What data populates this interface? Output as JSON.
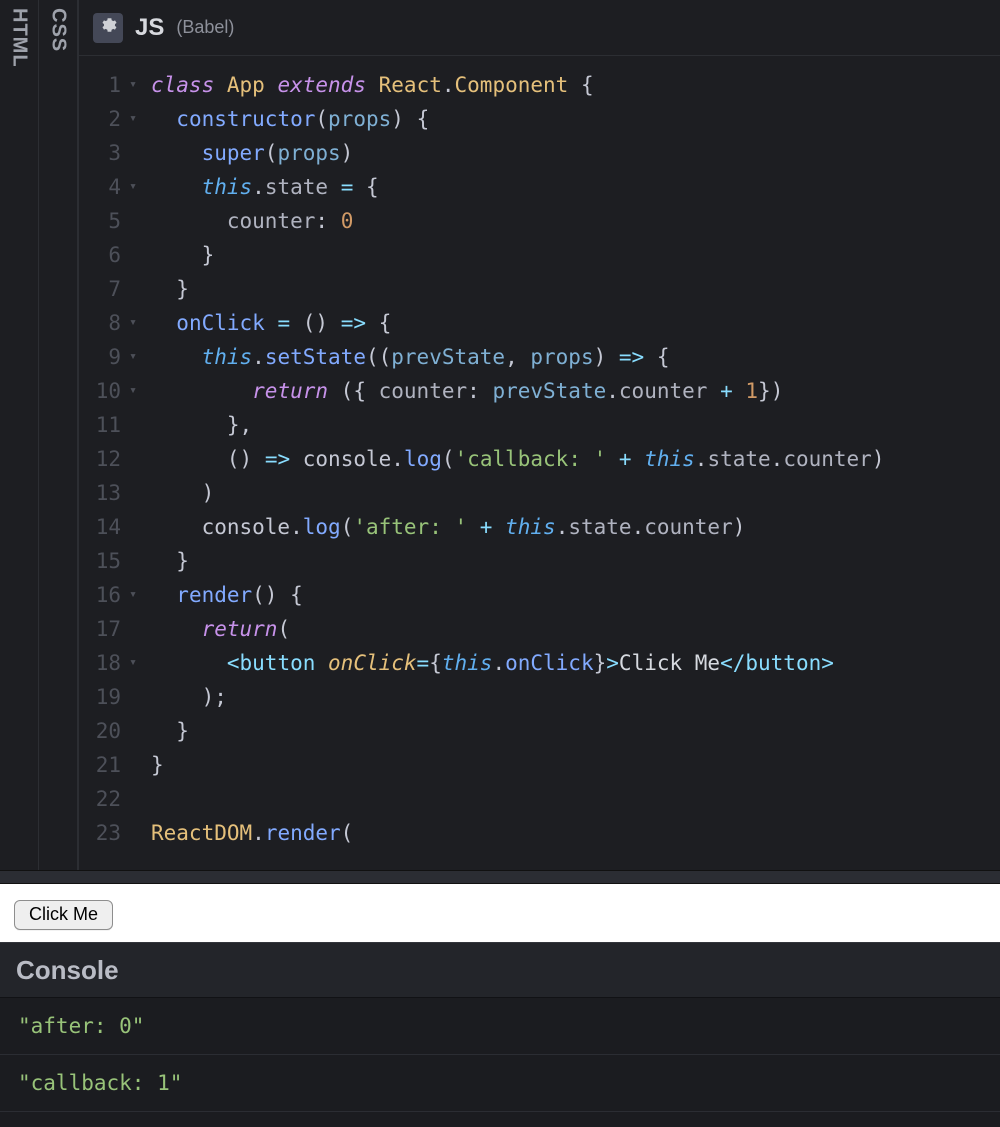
{
  "sideTabs": {
    "css": "CSS",
    "html": "HTML"
  },
  "editor": {
    "title": "JS",
    "subtitle": "(Babel)",
    "lines": [
      {
        "n": 1,
        "fold": true
      },
      {
        "n": 2,
        "fold": true
      },
      {
        "n": 3,
        "fold": false
      },
      {
        "n": 4,
        "fold": true
      },
      {
        "n": 5,
        "fold": false
      },
      {
        "n": 6,
        "fold": false
      },
      {
        "n": 7,
        "fold": false
      },
      {
        "n": 8,
        "fold": true
      },
      {
        "n": 9,
        "fold": true
      },
      {
        "n": 10,
        "fold": true
      },
      {
        "n": 11,
        "fold": false
      },
      {
        "n": 12,
        "fold": false
      },
      {
        "n": 13,
        "fold": false
      },
      {
        "n": 14,
        "fold": false
      },
      {
        "n": 15,
        "fold": false
      },
      {
        "n": 16,
        "fold": true
      },
      {
        "n": 17,
        "fold": false
      },
      {
        "n": 18,
        "fold": true
      },
      {
        "n": 19,
        "fold": false
      },
      {
        "n": 20,
        "fold": false
      },
      {
        "n": 21,
        "fold": false
      },
      {
        "n": 22,
        "fold": false
      },
      {
        "n": 23,
        "fold": false
      }
    ],
    "codeRows": [
      [
        [
          "kw",
          "class"
        ],
        [
          "",
          ""
        ],
        [
          "cls",
          "App"
        ],
        [
          "",
          ""
        ],
        [
          "kw",
          "extends"
        ],
        [
          "",
          ""
        ],
        [
          "cls",
          "React"
        ],
        [
          "punc",
          "."
        ],
        [
          "cls",
          "Component"
        ],
        [
          "",
          ""
        ],
        [
          "punc",
          "{"
        ]
      ],
      [
        [
          "",
          "  "
        ],
        [
          "fn",
          "constructor"
        ],
        [
          "punc",
          "("
        ],
        [
          "prop",
          "props"
        ],
        [
          "punc",
          ")"
        ],
        [
          "",
          ""
        ],
        [
          "punc",
          "{"
        ]
      ],
      [
        [
          "",
          "    "
        ],
        [
          "fn",
          "super"
        ],
        [
          "punc",
          "("
        ],
        [
          "prop",
          "props"
        ],
        [
          "punc",
          ")"
        ]
      ],
      [
        [
          "",
          "    "
        ],
        [
          "this",
          "this"
        ],
        [
          "punc",
          "."
        ],
        [
          "mem",
          "state"
        ],
        [
          "",
          ""
        ],
        [
          "op",
          "="
        ],
        [
          "",
          ""
        ],
        [
          "punc",
          "{"
        ]
      ],
      [
        [
          "",
          "      "
        ],
        [
          "mem",
          "counter"
        ],
        [
          "punc",
          ":"
        ],
        [
          "",
          ""
        ],
        [
          "num",
          "0"
        ]
      ],
      [
        [
          "",
          "    "
        ],
        [
          "punc",
          "}"
        ]
      ],
      [
        [
          "",
          "  "
        ],
        [
          "punc",
          "}"
        ]
      ],
      [
        [
          "",
          "  "
        ],
        [
          "fn",
          "onClick"
        ],
        [
          "",
          ""
        ],
        [
          "op",
          "="
        ],
        [
          "",
          ""
        ],
        [
          "punc",
          "()"
        ],
        [
          "",
          ""
        ],
        [
          "op",
          "=>"
        ],
        [
          "",
          ""
        ],
        [
          "punc",
          "{"
        ]
      ],
      [
        [
          "",
          "    "
        ],
        [
          "this",
          "this"
        ],
        [
          "punc",
          "."
        ],
        [
          "fn",
          "setState"
        ],
        [
          "punc",
          "(("
        ],
        [
          "prop",
          "prevState"
        ],
        [
          "punc",
          ","
        ],
        [
          "",
          ""
        ],
        [
          "prop",
          "props"
        ],
        [
          "punc",
          ")"
        ],
        [
          "",
          ""
        ],
        [
          "op",
          "=>"
        ],
        [
          "",
          ""
        ],
        [
          "punc",
          "{"
        ]
      ],
      [
        [
          "",
          "        "
        ],
        [
          "kw",
          "return"
        ],
        [
          "",
          ""
        ],
        [
          "punc",
          "({"
        ],
        [
          "",
          ""
        ],
        [
          "mem",
          "counter"
        ],
        [
          "punc",
          ":"
        ],
        [
          "",
          ""
        ],
        [
          "prop",
          "prevState"
        ],
        [
          "punc",
          "."
        ],
        [
          "mem",
          "counter"
        ],
        [
          "",
          ""
        ],
        [
          "op",
          "+"
        ],
        [
          "",
          ""
        ],
        [
          "num",
          "1"
        ],
        [
          "punc",
          "})"
        ]
      ],
      [
        [
          "",
          "      "
        ],
        [
          "punc",
          "},"
        ]
      ],
      [
        [
          "",
          "      "
        ],
        [
          "punc",
          "()"
        ],
        [
          "",
          ""
        ],
        [
          "op",
          "=>"
        ],
        [
          "",
          ""
        ],
        [
          "id",
          "console"
        ],
        [
          "punc",
          "."
        ],
        [
          "fn",
          "log"
        ],
        [
          "punc",
          "("
        ],
        [
          "str",
          "'callback: '"
        ],
        [
          "",
          ""
        ],
        [
          "op",
          "+"
        ],
        [
          "",
          ""
        ],
        [
          "this",
          "this"
        ],
        [
          "punc",
          "."
        ],
        [
          "mem",
          "state"
        ],
        [
          "punc",
          "."
        ],
        [
          "mem",
          "counter"
        ],
        [
          "punc",
          ")"
        ]
      ],
      [
        [
          "",
          "    "
        ],
        [
          "punc",
          ")"
        ]
      ],
      [
        [
          "",
          "    "
        ],
        [
          "id",
          "console"
        ],
        [
          "punc",
          "."
        ],
        [
          "fn",
          "log"
        ],
        [
          "punc",
          "("
        ],
        [
          "str",
          "'after: '"
        ],
        [
          "",
          ""
        ],
        [
          "op",
          "+"
        ],
        [
          "",
          ""
        ],
        [
          "this",
          "this"
        ],
        [
          "punc",
          "."
        ],
        [
          "mem",
          "state"
        ],
        [
          "punc",
          "."
        ],
        [
          "mem",
          "counter"
        ],
        [
          "punc",
          ")"
        ]
      ],
      [
        [
          "",
          "  "
        ],
        [
          "punc",
          "}"
        ]
      ],
      [
        [
          "",
          "  "
        ],
        [
          "fn",
          "render"
        ],
        [
          "punc",
          "()"
        ],
        [
          "",
          ""
        ],
        [
          "punc",
          "{"
        ]
      ],
      [
        [
          "",
          "    "
        ],
        [
          "kw",
          "return"
        ],
        [
          "punc",
          "("
        ]
      ],
      [
        [
          "",
          "      "
        ],
        [
          "tag",
          "<"
        ],
        [
          "tag",
          "button"
        ],
        [
          "",
          ""
        ],
        [
          "attr",
          "onClick"
        ],
        [
          "op",
          "="
        ],
        [
          "punc",
          "{"
        ],
        [
          "this",
          "this"
        ],
        [
          "punc",
          "."
        ],
        [
          "fn",
          "onClick"
        ],
        [
          "punc",
          "}"
        ],
        [
          "tag",
          ">"
        ],
        [
          "txt",
          "Click Me"
        ],
        [
          "tag",
          "</"
        ],
        [
          "tag",
          "button"
        ],
        [
          "tag",
          ">"
        ]
      ],
      [
        [
          "",
          "    "
        ],
        [
          "punc",
          ");"
        ]
      ],
      [
        [
          "",
          "  "
        ],
        [
          "punc",
          "}"
        ]
      ],
      [
        [
          "punc",
          "}"
        ]
      ],
      [],
      [
        [
          "cls",
          "ReactDOM"
        ],
        [
          "punc",
          "."
        ],
        [
          "fn",
          "render"
        ],
        [
          "punc",
          "("
        ]
      ]
    ]
  },
  "preview": {
    "buttonLabel": "Click Me"
  },
  "console": {
    "title": "Console",
    "lines": [
      "\"after: 0\"",
      "\"callback: 1\""
    ]
  }
}
